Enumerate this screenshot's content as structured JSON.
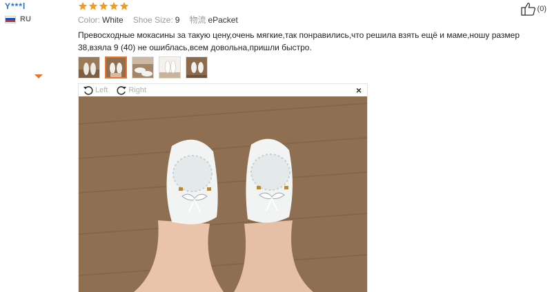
{
  "reviewer": {
    "name": "Y***l",
    "country_code": "RU",
    "flag_icon": "russia-flag-icon"
  },
  "rating": {
    "stars": 5,
    "max": 5,
    "color": "#f39b1e"
  },
  "meta": {
    "color_label": "Color:",
    "color_value": "White",
    "size_label": "Shoe Size:",
    "size_value": "9",
    "shipping_label": "物流",
    "shipping_value": "ePacket"
  },
  "review": {
    "text": "Превосходные мокасины за такую цену,очень мягкие,так понравились,что решила взять ещё и маме,ношу размер 38,взяла 9 (40) не ошиблась,всем довольна,пришли быстро."
  },
  "photos": {
    "count": 5,
    "active_index": 1
  },
  "viewer": {
    "rotate_left_label": "Left",
    "rotate_right_label": "Right",
    "close_label": "×"
  },
  "helpful": {
    "count": "(0)"
  },
  "colors": {
    "accent": "#e8752b",
    "username": "#2a6fb9",
    "muted": "#999999"
  }
}
